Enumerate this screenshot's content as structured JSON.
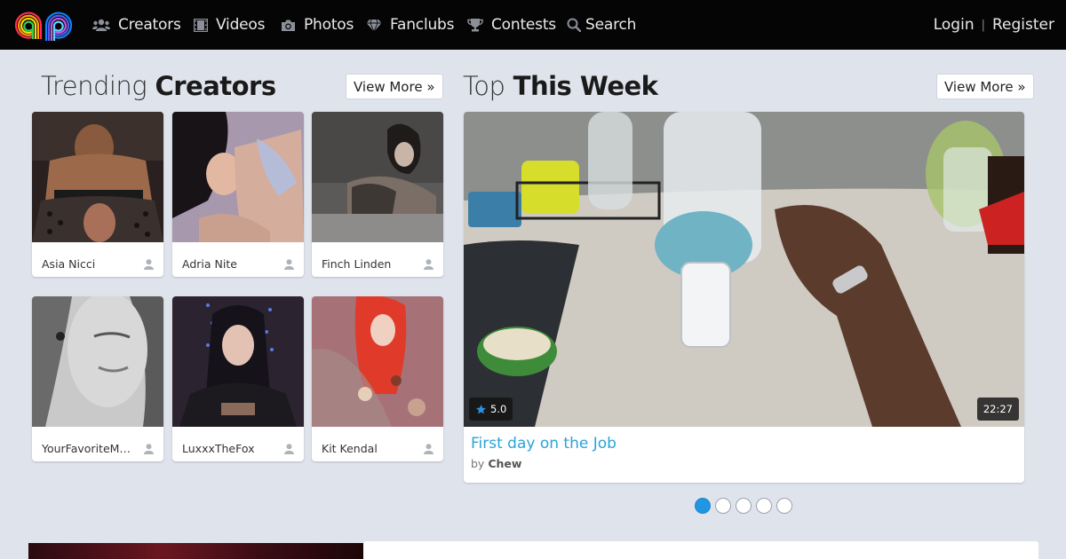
{
  "nav": {
    "items": [
      {
        "label": "Creators",
        "icon": "users-icon"
      },
      {
        "label": "Videos",
        "icon": "film-icon"
      },
      {
        "label": "Photos",
        "icon": "camera-icon"
      },
      {
        "label": "Fanclubs",
        "icon": "diamond-icon"
      },
      {
        "label": "Contests",
        "icon": "trophy-icon"
      },
      {
        "label": "Search",
        "icon": "search-icon"
      }
    ],
    "login": "Login",
    "separator": "|",
    "register": "Register"
  },
  "trending": {
    "title_light": "Trending",
    "title_bold": "Creators",
    "view_more": "View More »",
    "creators": [
      {
        "name": "Asia Nicci"
      },
      {
        "name": "Adria Nite"
      },
      {
        "name": "Finch Linden"
      },
      {
        "name": "YourFavoriteMo…"
      },
      {
        "name": "LuxxxTheFox"
      },
      {
        "name": "Kit Kendal"
      }
    ]
  },
  "top_week": {
    "title_light": "Top",
    "title_bold": "This Week",
    "view_more": "View More »",
    "feature": {
      "rating": "5.0",
      "duration": "22:27",
      "title": "First day on the Job",
      "by_prefix": "by",
      "author": "Chew"
    },
    "carousel": {
      "count": 5,
      "active": 0
    }
  },
  "colors": {
    "background": "#dfe3ec",
    "navbar": "#050505",
    "link_blue": "#2aa3d8",
    "dot_active": "#2196e3"
  }
}
